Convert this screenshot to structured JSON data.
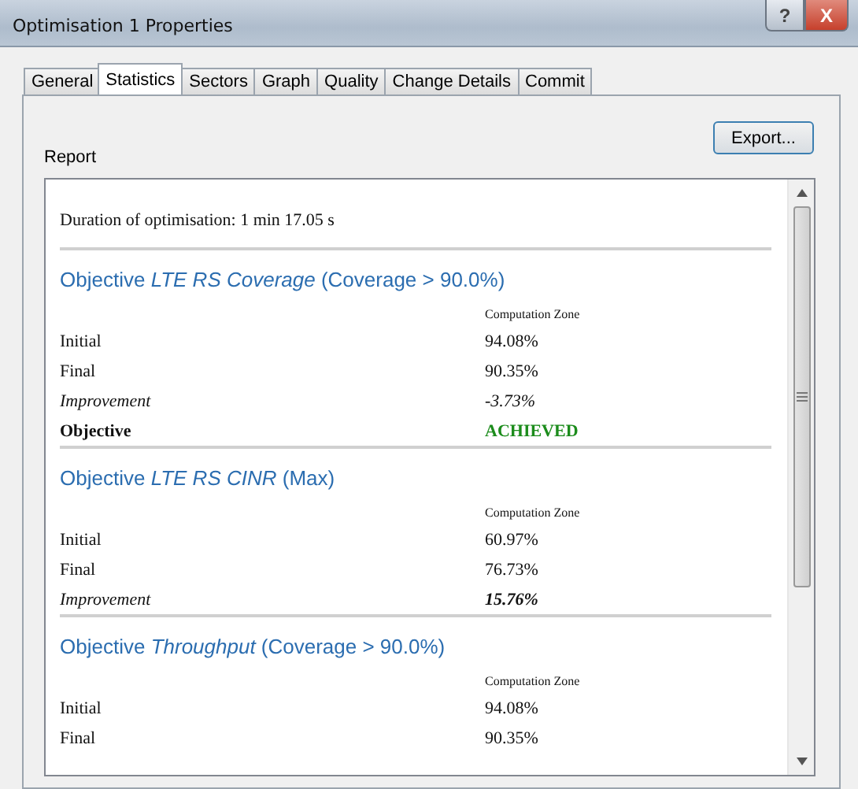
{
  "window": {
    "title": "Optimisation 1 Properties",
    "help_button": "?",
    "close_button": "X"
  },
  "tabs": [
    {
      "label": "General",
      "selected": false
    },
    {
      "label": "Statistics",
      "selected": true
    },
    {
      "label": "Sectors",
      "selected": false
    },
    {
      "label": "Graph",
      "selected": false
    },
    {
      "label": "Quality",
      "selected": false
    },
    {
      "label": "Change Details",
      "selected": false
    },
    {
      "label": "Commit",
      "selected": false
    }
  ],
  "export_button": "Export...",
  "report": {
    "label": "Report",
    "duration": "Duration of optimisation: 1 min 17.05 s",
    "objectives": [
      {
        "heading": "Objective *LTE RS Coverage* (Coverage > 90.0%)",
        "column_header": "Computation Zone",
        "rows": [
          {
            "kind": "plain",
            "label": "Initial",
            "value": "94.08%"
          },
          {
            "kind": "plain",
            "label": "Final",
            "value": "90.35%"
          },
          {
            "kind": "improvement",
            "label": "Improvement",
            "value": "-3.73%",
            "bold": false
          },
          {
            "kind": "status",
            "label": "Objective",
            "value": "ACHIEVED"
          }
        ]
      },
      {
        "heading": "Objective *LTE RS CINR* (Max)",
        "column_header": "Computation Zone",
        "rows": [
          {
            "kind": "plain",
            "label": "Initial",
            "value": "60.97%"
          },
          {
            "kind": "plain",
            "label": "Final",
            "value": "76.73%"
          },
          {
            "kind": "improvement",
            "label": "Improvement",
            "value": "15.76%",
            "bold": true
          }
        ]
      },
      {
        "heading": "Objective *Throughput* (Coverage > 90.0%)",
        "column_header": "Computation Zone",
        "rows": [
          {
            "kind": "plain",
            "label": "Initial",
            "value": "94.08%"
          },
          {
            "kind": "plain",
            "label": "Final",
            "value": "90.35%"
          }
        ]
      }
    ]
  }
}
